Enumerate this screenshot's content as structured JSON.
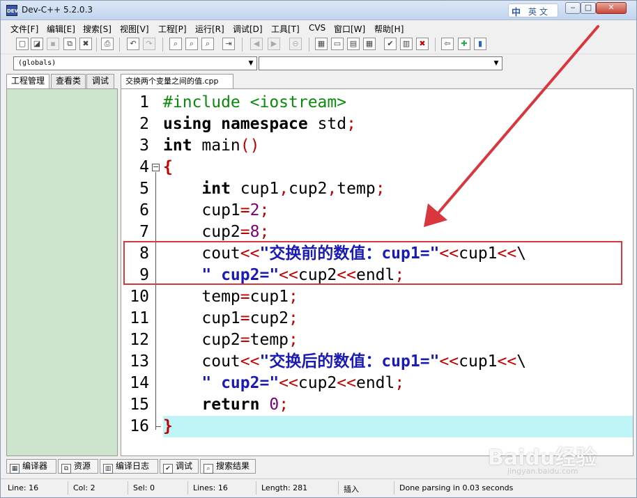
{
  "window": {
    "title": "Dev-C++ 5.2.0.3",
    "app_icon": "DEV",
    "ime_logo": "中",
    "ime_language": "英 文",
    "min_glyph": "‒",
    "max_glyph": "□",
    "close_glyph": "✕"
  },
  "menu": [
    "文件[F]",
    "编辑[E]",
    "搜索[S]",
    "视图[V]",
    "工程[P]",
    "运行[R]",
    "调试[D]",
    "工具[T]",
    "CVS",
    "窗口[W]",
    "帮助[H]"
  ],
  "toolbar": {
    "icons": [
      "new-file-icon",
      "open-file-icon",
      "save-icon",
      "save-all-icon",
      "close-file-icon",
      "print-icon",
      "undo-icon",
      "redo-icon",
      "find-icon",
      "replace-icon",
      "find-next-icon",
      "goto-line-icon",
      "indent-left-icon",
      "indent-right-icon",
      "toggle-comment-icon",
      "new-project-icon",
      "class-browser-icon",
      "compile-icon",
      "run-icon",
      "check-icon",
      "chart-icon",
      "delete-icon",
      "exit-icon",
      "add-file-icon",
      "info-icon"
    ]
  },
  "combos": {
    "scope": "(globals)",
    "member": ""
  },
  "left_tabs": [
    "工程管理",
    "查看类",
    "调试"
  ],
  "file_tab": "交换两个变量之间的值.cpp",
  "code": {
    "current_line": 16,
    "lines": [
      {
        "n": "1",
        "tokens": [
          [
            "pp",
            "#include <iostream>"
          ]
        ]
      },
      {
        "n": "2",
        "tokens": [
          [
            "kw",
            "using"
          ],
          [
            "id",
            " "
          ],
          [
            "kw",
            "namespace"
          ],
          [
            "id",
            " std"
          ],
          [
            "op",
            ";"
          ]
        ]
      },
      {
        "n": "3",
        "tokens": [
          [
            "kw",
            "int"
          ],
          [
            "id",
            " main"
          ],
          [
            "op",
            "()"
          ]
        ]
      },
      {
        "n": "4",
        "tokens": [
          [
            "br",
            "{"
          ]
        ]
      },
      {
        "n": "5",
        "tokens": [
          [
            "id",
            "    "
          ],
          [
            "kw",
            "int"
          ],
          [
            "id",
            " cup1"
          ],
          [
            "op",
            ","
          ],
          [
            "id",
            "cup2"
          ],
          [
            "op",
            ","
          ],
          [
            "id",
            "temp"
          ],
          [
            "op",
            ";"
          ]
        ]
      },
      {
        "n": "6",
        "tokens": [
          [
            "id",
            "    cup1"
          ],
          [
            "op",
            "="
          ],
          [
            "num",
            "2"
          ],
          [
            "op",
            ";"
          ]
        ]
      },
      {
        "n": "7",
        "tokens": [
          [
            "id",
            "    cup2"
          ],
          [
            "op",
            "="
          ],
          [
            "num",
            "8"
          ],
          [
            "op",
            ";"
          ]
        ]
      },
      {
        "n": "8",
        "tokens": [
          [
            "id",
            "    cout"
          ],
          [
            "op",
            "<<"
          ],
          [
            "str",
            "\"交换前的数值：cup1=\""
          ],
          [
            "op",
            "<<"
          ],
          [
            "id",
            "cup1"
          ],
          [
            "op",
            "<<"
          ],
          [
            "id",
            "\\"
          ]
        ]
      },
      {
        "n": "9",
        "tokens": [
          [
            "str",
            "    \" cup2=\""
          ],
          [
            "op",
            "<<"
          ],
          [
            "id",
            "cup2"
          ],
          [
            "op",
            "<<"
          ],
          [
            "id",
            "endl"
          ],
          [
            "op",
            ";"
          ]
        ]
      },
      {
        "n": "10",
        "tokens": [
          [
            "id",
            "    temp"
          ],
          [
            "op",
            "="
          ],
          [
            "id",
            "cup1"
          ],
          [
            "op",
            ";"
          ]
        ]
      },
      {
        "n": "11",
        "tokens": [
          [
            "id",
            "    cup1"
          ],
          [
            "op",
            "="
          ],
          [
            "id",
            "cup2"
          ],
          [
            "op",
            ";"
          ]
        ]
      },
      {
        "n": "12",
        "tokens": [
          [
            "id",
            "    cup2"
          ],
          [
            "op",
            "="
          ],
          [
            "id",
            "temp"
          ],
          [
            "op",
            ";"
          ]
        ]
      },
      {
        "n": "13",
        "tokens": [
          [
            "id",
            "    cout"
          ],
          [
            "op",
            "<<"
          ],
          [
            "str",
            "\"交换后的数值：cup1=\""
          ],
          [
            "op",
            "<<"
          ],
          [
            "id",
            "cup1"
          ],
          [
            "op",
            "<<"
          ],
          [
            "id",
            "\\"
          ]
        ]
      },
      {
        "n": "14",
        "tokens": [
          [
            "str",
            "    \" cup2=\""
          ],
          [
            "op",
            "<<"
          ],
          [
            "id",
            "cup2"
          ],
          [
            "op",
            "<<"
          ],
          [
            "id",
            "endl"
          ],
          [
            "op",
            ";"
          ]
        ]
      },
      {
        "n": "15",
        "tokens": [
          [
            "id",
            "    "
          ],
          [
            "kw",
            "return"
          ],
          [
            "id",
            " "
          ],
          [
            "num",
            "0"
          ],
          [
            "op",
            ";"
          ]
        ]
      },
      {
        "n": "16",
        "tokens": [
          [
            "br",
            "}"
          ]
        ]
      }
    ]
  },
  "bottom_tabs": [
    {
      "label": "编译器",
      "icon": "compiler-icon"
    },
    {
      "label": "资源",
      "icon": "resources-icon"
    },
    {
      "label": "编译日志",
      "icon": "compile-log-icon"
    },
    {
      "label": "调试",
      "icon": "debug-icon"
    },
    {
      "label": "搜索结果",
      "icon": "search-results-icon"
    }
  ],
  "status": {
    "line": "Line:   16",
    "col": "Col:   2",
    "sel": "Sel:   0",
    "lines": "Lines:   16",
    "length": "Length:   281",
    "mode": "插入",
    "message": "Done parsing in 0.03 seconds"
  },
  "watermark": "Baidu经验",
  "watermark_sub": "jingyan.baidu.com",
  "colors": {
    "annotation_red": "#d9363e",
    "current_line": "#c0f5f8",
    "left_panel": "#cde5cd"
  }
}
